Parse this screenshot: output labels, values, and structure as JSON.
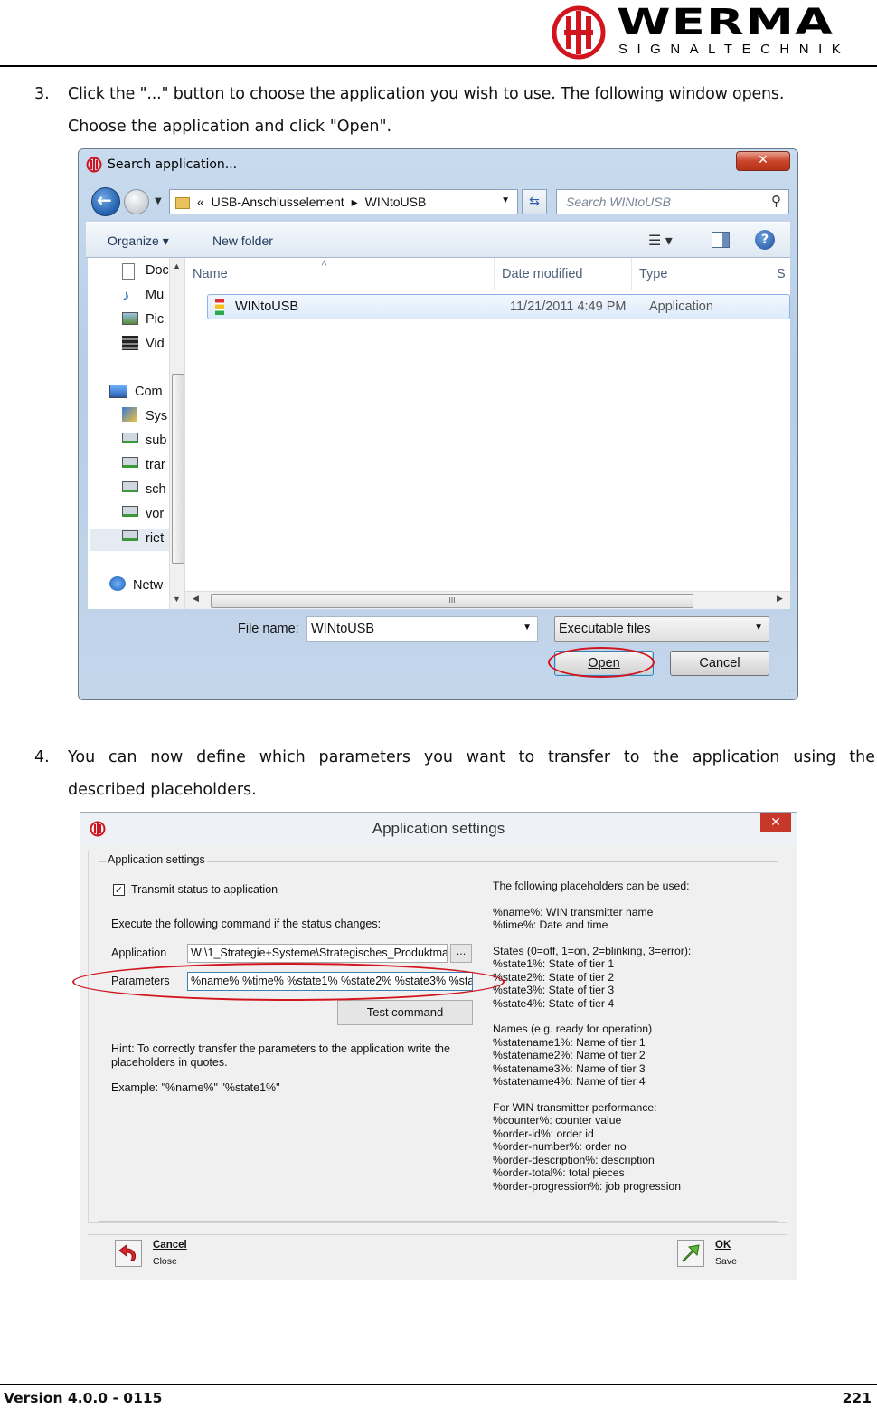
{
  "header": {
    "brand": "WERMA",
    "tagline": "SIGNALTECHNIK",
    "accent_color": "#d2141e"
  },
  "steps": [
    {
      "number": "3.",
      "line1": "Click the \"...\" button to choose the application you wish to use. The following window opens.",
      "line2": "Choose the application and click \"Open\"."
    },
    {
      "number": "4.",
      "line1": "You can now define which parameters you want to transfer to the application using the",
      "line2": "described placeholders."
    }
  ],
  "open_dialog": {
    "title": "Search application...",
    "close_glyph": "✕",
    "address_prefix": "«",
    "address_parts": [
      "USB-Anschlusselement",
      "WINtoUSB"
    ],
    "address_sep": "▸",
    "search_placeholder": "Search WINtoUSB",
    "toolbar": {
      "organize": "Organize ▾",
      "new_folder": "New folder"
    },
    "nav_items": [
      "Doc",
      "Mu",
      "Pic",
      "Vid",
      "Com",
      "Sys",
      "sub",
      "trar",
      "sch",
      "vor",
      "riet",
      "Netw"
    ],
    "columns": [
      "Name",
      "Date modified",
      "Type",
      "S"
    ],
    "file": {
      "name": "WINtoUSB",
      "date": "11/21/2011 4:49 PM",
      "type": "Application"
    },
    "scroll_grip": "III",
    "file_name_label": "File name:",
    "file_name_value": "WINtoUSB",
    "filter": "Executable files",
    "open_button": "Open",
    "cancel_button": "Cancel"
  },
  "settings_dialog": {
    "title": "Application settings",
    "close_glyph": "✕",
    "group_label": "Application settings",
    "checkbox_label": "Transmit status to application",
    "checkbox_checked": true,
    "execute_label": "Execute the following command if the status changes:",
    "application_label": "Application",
    "application_value": "W:\\1_Strategie+Systeme\\Strategisches_Produktma",
    "browse_button": "...",
    "parameters_label": "Parameters",
    "parameters_value": "%name% %time% %state1% %state2% %state3% %state4%",
    "test_button": "Test command",
    "hint_line1": "Hint: To correctly transfer the parameters to the application write the",
    "hint_line2": "placeholders in quotes.",
    "example": "Example: \"%name%\" \"%state1%\"",
    "placeholders": {
      "intro": "The following placeholders can be used:",
      "basic": [
        "%name%: WIN transmitter name",
        "%time%: Date and time"
      ],
      "states_title": "States (0=off, 1=on, 2=blinking, 3=error):",
      "states": [
        "%state1%: State of tier 1",
        "%state2%: State of tier 2",
        "%state3%: State of tier 3",
        "%state4%: State of tier 4"
      ],
      "names_title": "Names (e.g. ready for operation)",
      "names": [
        "%statename1%: Name of tier 1",
        "%statename2%: Name of tier 2",
        "%statename3%: Name of tier 3",
        "%statename4%: Name of tier 4"
      ],
      "perf_title": "For WIN transmitter performance:",
      "perf": [
        "%counter%: counter value",
        "%order-id%: order id",
        "%order-number%: order no",
        "%order-description%: description",
        "%order-total%: total pieces",
        "%order-progression%: job progression"
      ]
    },
    "cancel_title": "Cancel",
    "cancel_sub": "Close",
    "ok_title": "OK",
    "ok_sub": "Save"
  },
  "footer": {
    "version": "Version 4.0.0 - 0115",
    "page": "221"
  }
}
